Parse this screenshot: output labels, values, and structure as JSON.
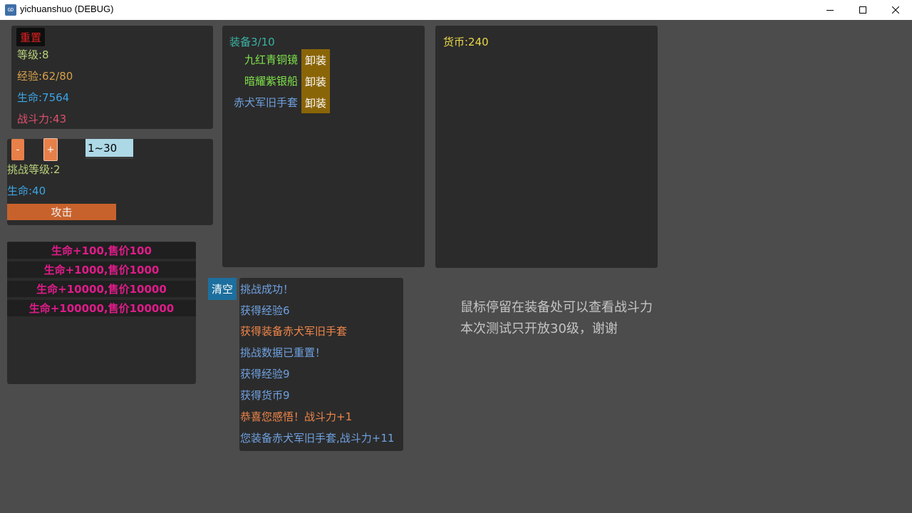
{
  "window": {
    "title": "yichuanshuo (DEBUG)",
    "icon": "app-icon-label",
    "icon_label": "GD"
  },
  "player": {
    "reset_label": "重置",
    "level": "等级:8",
    "exp": "经验:62/80",
    "hp": "生命:7564",
    "power": "战斗力:43"
  },
  "challenge": {
    "minus_label": "-",
    "plus_label": "+",
    "range_value": "1~30",
    "level": "挑战等级:2",
    "hp": "生命:40",
    "attack_label": "攻击"
  },
  "shop": {
    "items": [
      "生命+100,售价100",
      "生命+1000,售价1000",
      "生命+10000,售价10000",
      "生命+100000,售价100000"
    ]
  },
  "equipment": {
    "header": "装备3/10",
    "unequip_label": "卸装",
    "items": [
      {
        "name": "九红青铜镜",
        "color": "#7fe34a"
      },
      {
        "name": "暗耀紫银船",
        "color": "#7fe34a"
      },
      {
        "name": "赤犬军旧手套",
        "color": "#6fa1e0"
      }
    ]
  },
  "currency": {
    "label": "货币:240"
  },
  "log": {
    "clear_label": "清空",
    "lines": [
      {
        "text": "挑战成功！",
        "color": "#6fa1e0"
      },
      {
        "text": "获得经验6",
        "color": "#6fa1e0"
      },
      {
        "text": "获得装备赤犬军旧手套",
        "color": "#f0864a"
      },
      {
        "text": "挑战数据已重置！",
        "color": "#6fa1e0"
      },
      {
        "text": "获得经验9",
        "color": "#6fa1e0"
      },
      {
        "text": "获得货币9",
        "color": "#6fa1e0"
      },
      {
        "text": "恭喜您感悟！战斗力+1",
        "color": "#f0864a"
      },
      {
        "text": "您装备赤犬军旧手套,战斗力+11",
        "color": "#6fa1e0"
      }
    ]
  },
  "notes": {
    "line1": "鼠标停留在装备处可以查看战斗力",
    "line2": "本次测试只开放30级，谢谢"
  },
  "colors": {
    "background": "#4c4c4c",
    "panel": "#2b2b2b",
    "level": "#b8d27a",
    "exp": "#d7a04a",
    "hp": "#3aa5e6",
    "power": "#e0506e",
    "reset_text": "#e02020",
    "attack_button": "#c8622c",
    "stepper_button": "#e8804a",
    "range_input": "#add8e6",
    "shop_text": "#e01b8a",
    "equip_header": "#3ab3a4",
    "unequip_button": "#8a6508",
    "currency": "#e8d84a",
    "clear_button": "#1c6f9e",
    "notes": "#c4c4c4"
  }
}
